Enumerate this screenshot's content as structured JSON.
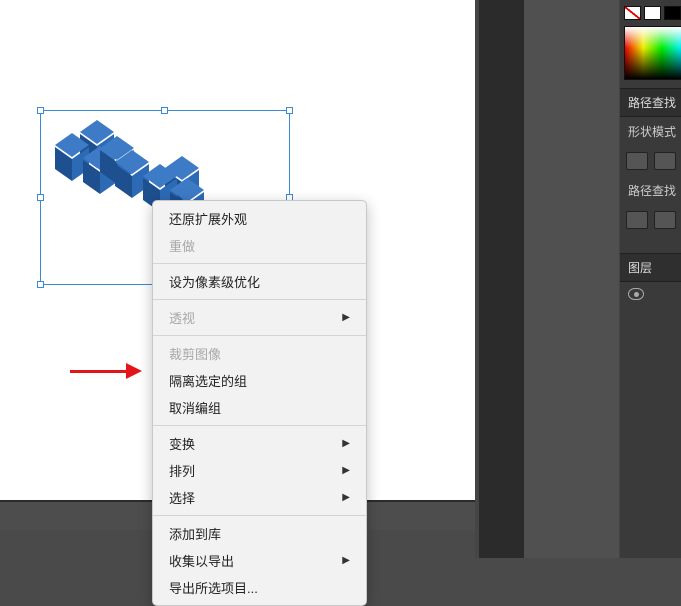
{
  "context_menu": {
    "undo_expand_appearance": "还原扩展外观",
    "redo": "重做",
    "pixel_perfect": "设为像素级优化",
    "perspective": "透视",
    "crop_image": "裁剪图像",
    "isolate_selected_group": "隔离选定的组",
    "ungroup": "取消编组",
    "transform": "变换",
    "arrange": "排列",
    "select": "选择",
    "add_to_library": "添加到库",
    "collect_for_export": "收集以导出",
    "export_selection": "导出所选项目..."
  },
  "right_panel": {
    "pathfinder_tab": "路径查找",
    "shape_mode": "形状模式",
    "pathfinder": "路径查找",
    "layers": "图层"
  }
}
